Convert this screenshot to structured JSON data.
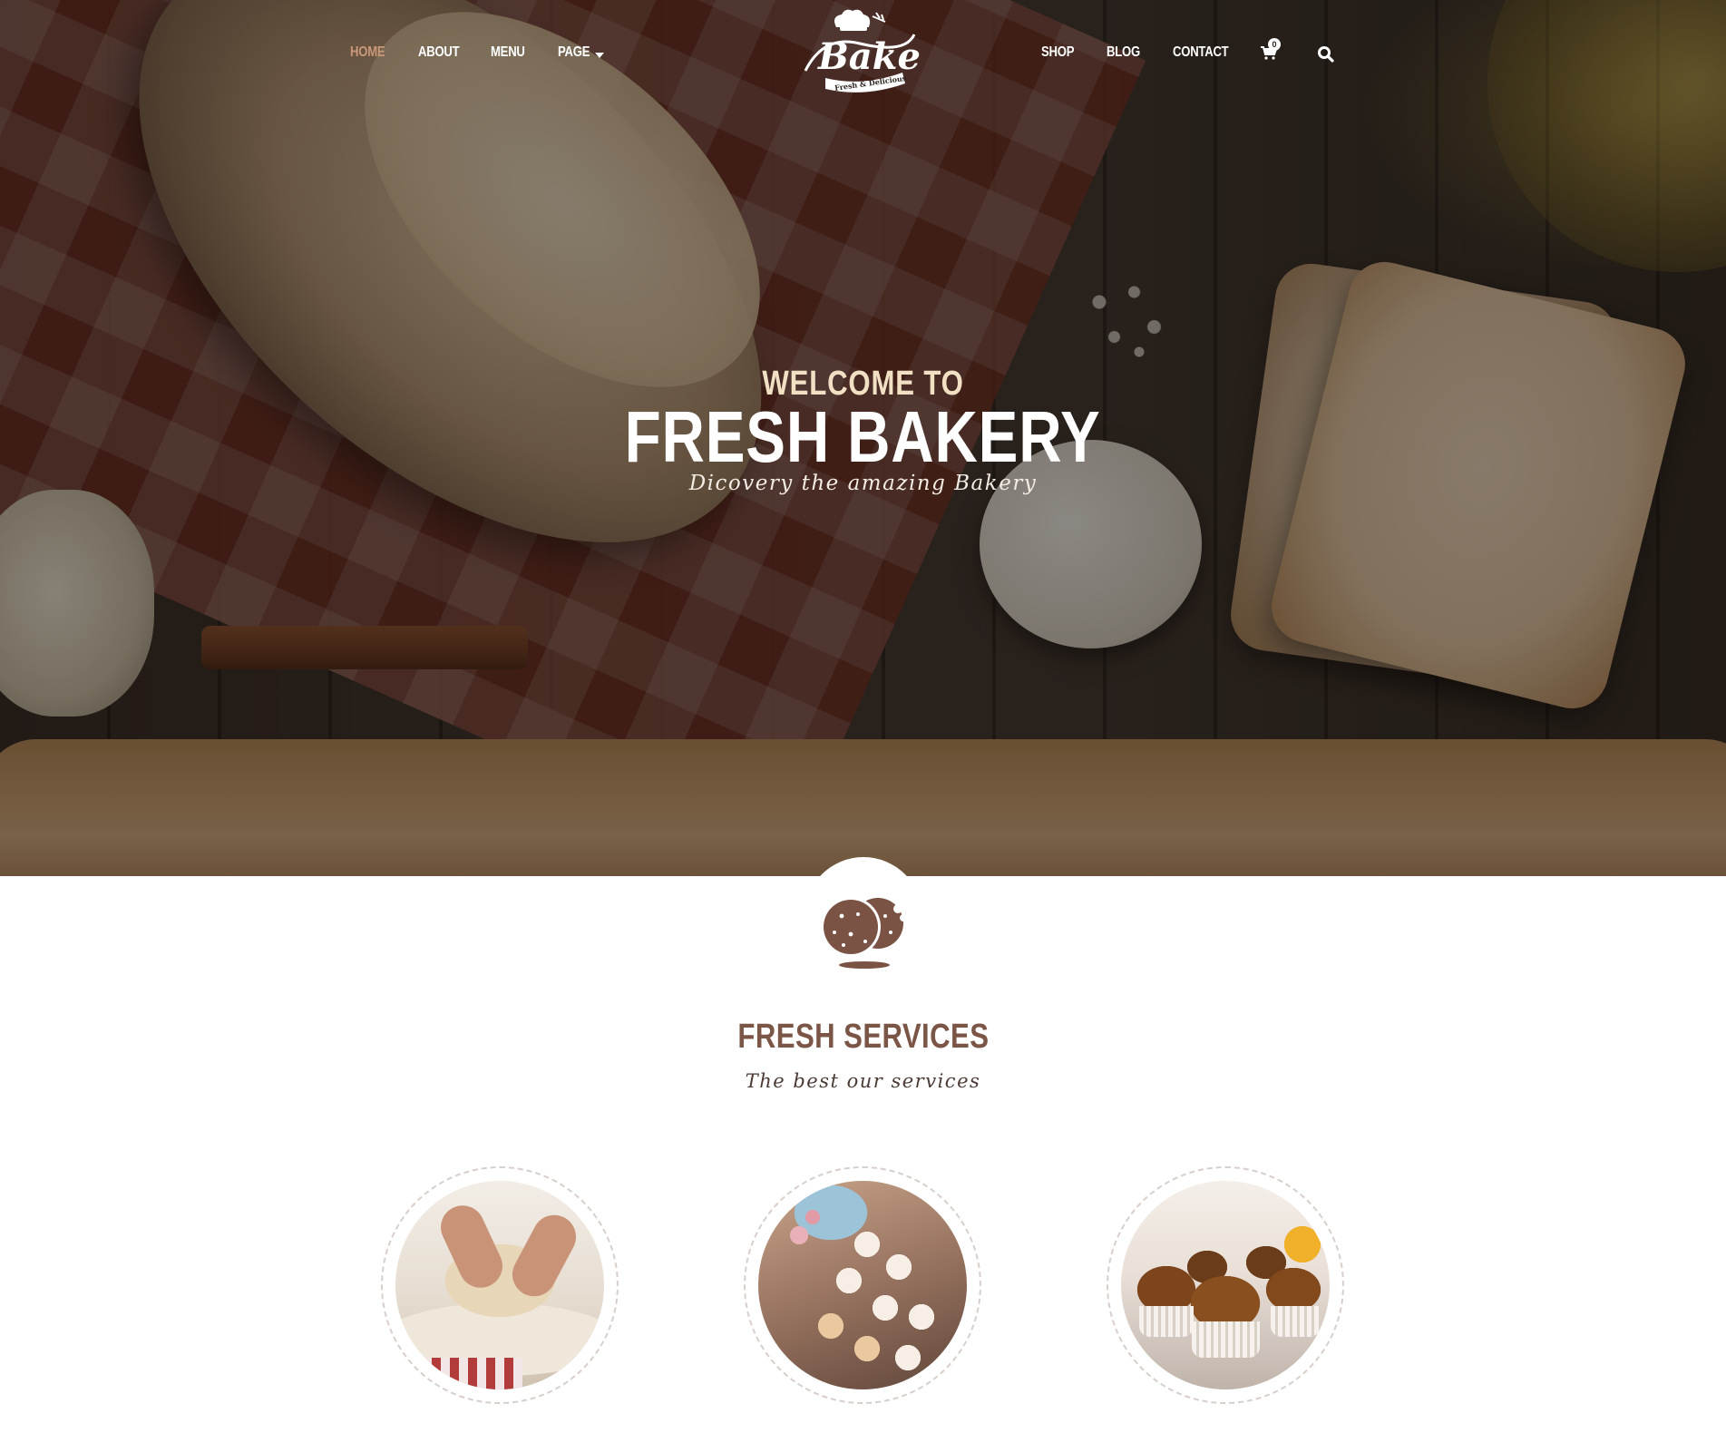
{
  "nav": {
    "left": [
      {
        "label": "HOME",
        "active": true
      },
      {
        "label": "ABOUT"
      },
      {
        "label": "MENU"
      },
      {
        "label": "PAGE"
      }
    ],
    "right": [
      {
        "label": "SHOP"
      },
      {
        "label": "BLOG"
      },
      {
        "label": "CONTACT"
      }
    ],
    "cart_count": "0",
    "icons": [
      "cart-icon",
      "search-icon",
      "chevron-down-icon"
    ]
  },
  "logo": {
    "name": "Bake",
    "tagline": "Fresh & Delicious"
  },
  "hero": {
    "welcome": "WELCOME TO",
    "title": "FRESH BAKERY",
    "subtitle": "Dicovery the amazing Bakery"
  },
  "services": {
    "title": "FRESH SERVICES",
    "subtitle": "The best our services",
    "icon": "cookie-icon",
    "items": [
      {
        "image": "kneading-dough-image"
      },
      {
        "image": "pastries-image"
      },
      {
        "image": "muffins-image"
      }
    ]
  },
  "colors": {
    "accent": "#c9987a",
    "heading_brown": "#7b5546",
    "cookie_brown": "#7a5345",
    "hero_overlay": "#1a120c"
  }
}
